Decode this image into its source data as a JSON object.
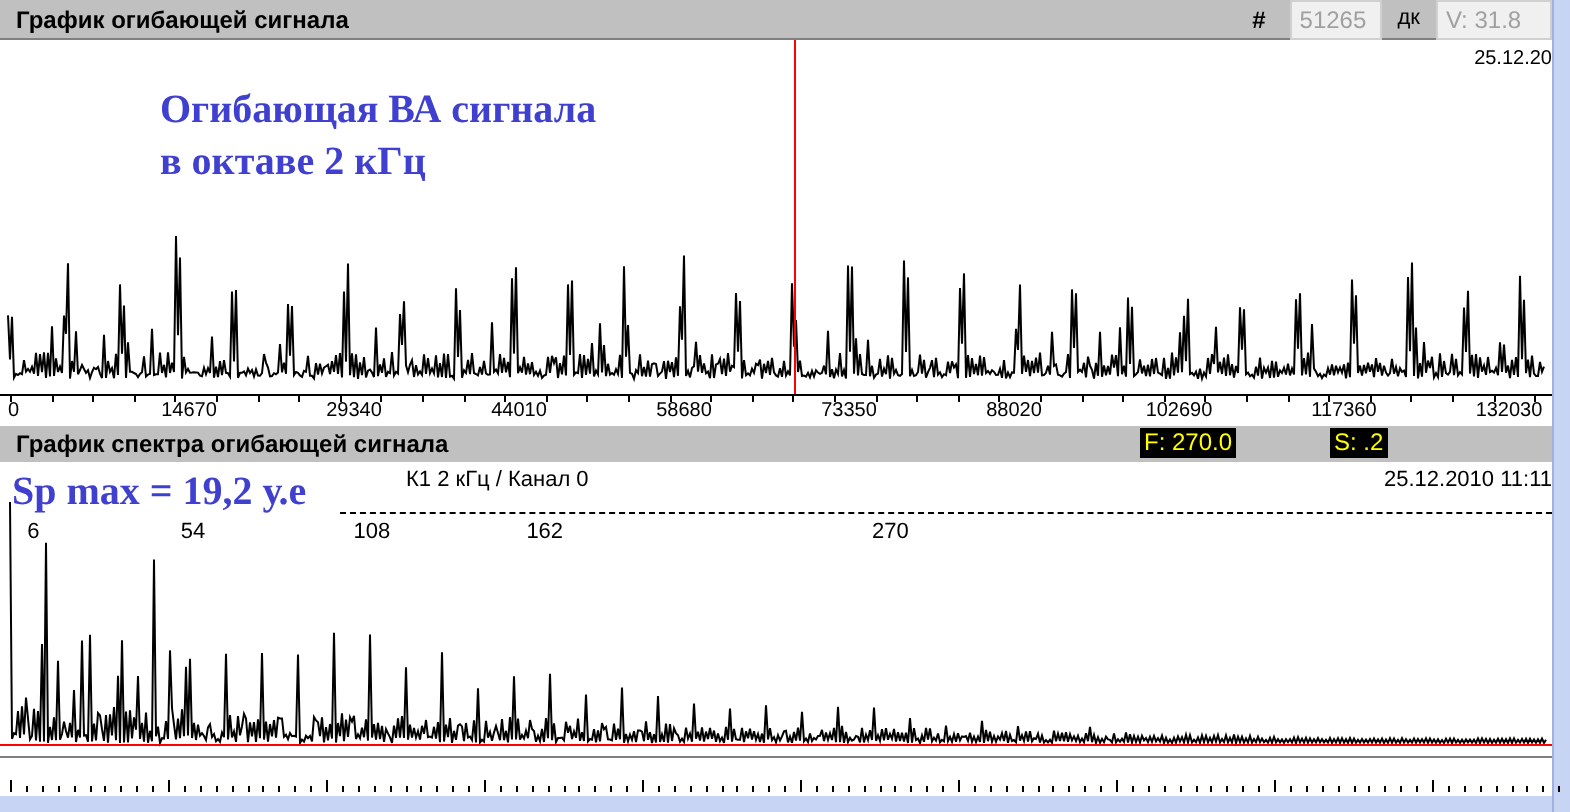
{
  "top_panel": {
    "title": "График огибающей сигнала",
    "hash_label": "#",
    "count_field": "51265",
    "dc_label": "дк",
    "value_field": "V: 31.8",
    "date": "25.12.20",
    "overlay_lines": [
      "Огибающая ВА сигнала",
      "в октаве 2 кГц"
    ],
    "axis_labels": [
      "0",
      "14670",
      "29340",
      "44010",
      "58680",
      "73350",
      "88020",
      "102690",
      "117360",
      "132030"
    ]
  },
  "bottom_panel": {
    "title": "График спектра огибающей сигнала",
    "frequency_badge": "F: 270.0",
    "s_badge": "S: .2",
    "caption": "К1 2 кГц / Канал 0",
    "date": "25.12.2010 11:11",
    "sp_max": "Sp max = 19,2 у.е",
    "peak_labels": [
      "6",
      "54",
      "108",
      "162",
      "270"
    ]
  }
}
